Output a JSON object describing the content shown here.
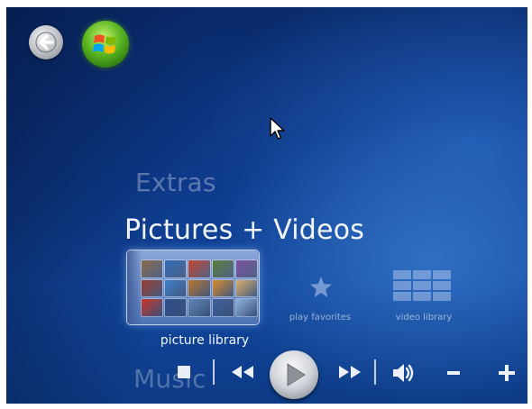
{
  "window": {
    "background_color": "#0d3a8a",
    "accent_color": "#59b521"
  },
  "navigation": {
    "back_icon": "back-arrow-icon",
    "start_icon": "windows-flag-icon"
  },
  "menu": {
    "items": [
      {
        "label": "Extras",
        "state": "dim"
      },
      {
        "label": "Pictures + Videos",
        "state": "selected"
      },
      {
        "label": "Music",
        "state": "dim"
      }
    ]
  },
  "strip": {
    "tiles": [
      {
        "label": "picture library",
        "icon": "photo-thumbnails",
        "focused": true
      },
      {
        "label": "play favorites",
        "icon": "star-icon",
        "focused": false
      },
      {
        "label": "video library",
        "icon": "video-grid-icon",
        "focused": false
      }
    ]
  },
  "thumbnails": [
    "#8b6a4a",
    "#2e6ab8",
    "#c8442e",
    "#5a7d3a",
    "#7d4fa0",
    "#9a3b2a",
    "#3d7fc9",
    "#b8742a",
    "#d68a2a",
    "#d9b06a",
    "#c9352a",
    "#2c4c8a",
    "#5d86b8",
    "#3f5f9c",
    "#8fb3e0"
  ],
  "transport": {
    "buttons": [
      "stop",
      "rewind",
      "play",
      "fast-forward",
      "mute",
      "volume-down",
      "volume-up"
    ]
  }
}
